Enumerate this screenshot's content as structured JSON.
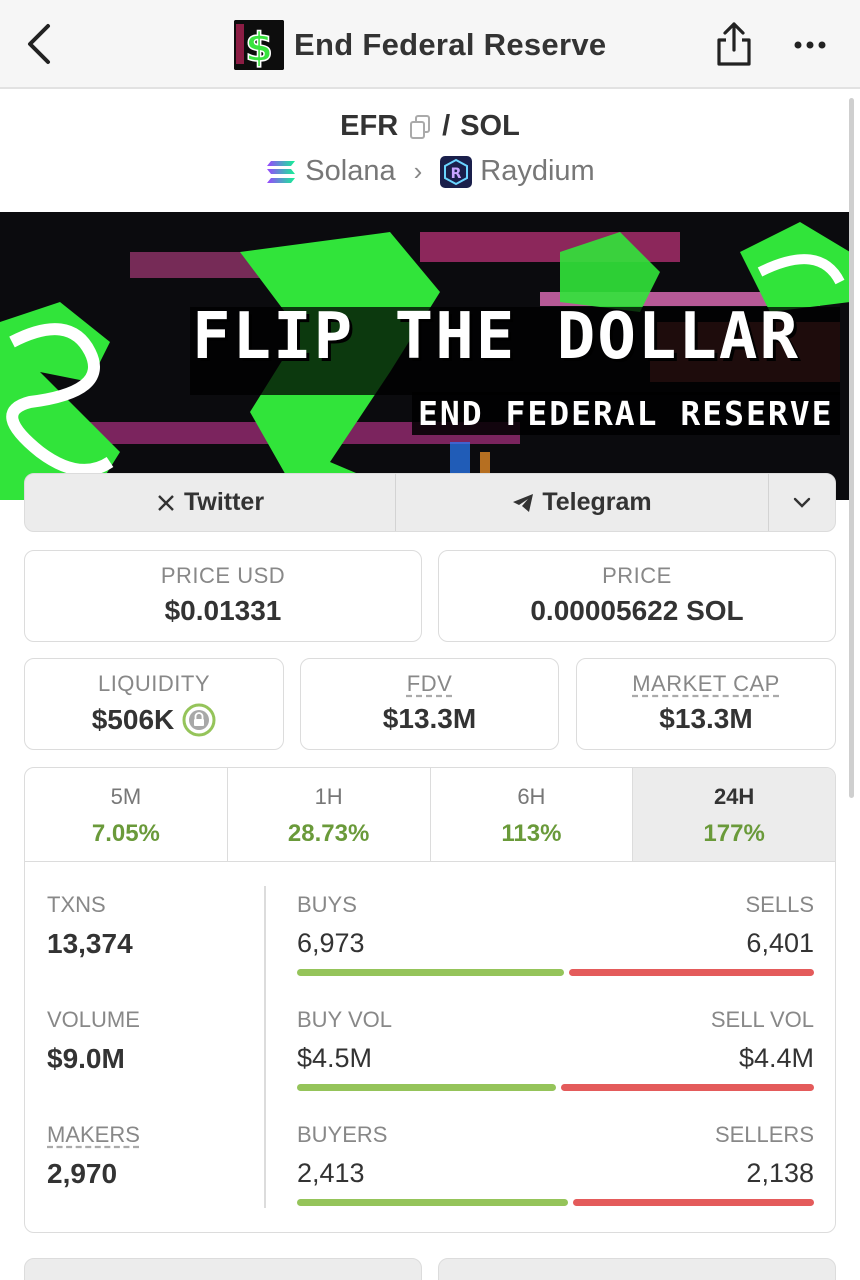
{
  "header": {
    "title": "End Federal Reserve",
    "back_icon": "chevron-left-icon",
    "share_icon": "share-icon",
    "more_icon": "more-horizontal-icon"
  },
  "pair": {
    "base": "EFR",
    "separator": "/",
    "quote": "SOL",
    "chain": "Solana",
    "dex": "Raydium"
  },
  "banner": {
    "line1": "FLIP THE DOLLAR",
    "line2": "END FEDERAL RESERVE"
  },
  "links": {
    "twitter": "Twitter",
    "telegram": "Telegram"
  },
  "prices": {
    "price_usd_label": "PRICE USD",
    "price_usd": "$0.01331",
    "price_label": "PRICE",
    "price_sol": "0.00005622 SOL"
  },
  "metrics": {
    "liquidity_label": "LIQUIDITY",
    "liquidity": "$506K",
    "fdv_label": "FDV",
    "fdv": "$13.3M",
    "mcap_label": "MARKET CAP",
    "mcap": "$13.3M"
  },
  "timeframes": [
    {
      "label": "5M",
      "change": "7.05%"
    },
    {
      "label": "1H",
      "change": "28.73%"
    },
    {
      "label": "6H",
      "change": "113%"
    },
    {
      "label": "24H",
      "change": "177%"
    }
  ],
  "stats": {
    "txns_label": "TXNS",
    "txns": "13,374",
    "volume_label": "VOLUME",
    "volume": "$9.0M",
    "makers_label": "MAKERS",
    "makers": "2,970",
    "buys_label": "BUYS",
    "buys": "6,973",
    "sells_label": "SELLS",
    "sells": "6,401",
    "buy_vol_label": "BUY VOL",
    "buy_vol": "$4.5M",
    "sell_vol_label": "SELL VOL",
    "sell_vol": "$4.4M",
    "buyers_label": "BUYERS",
    "buyers": "2,413",
    "sellers_label": "SELLERS",
    "sellers": "2,138"
  },
  "bar_fractions": {
    "buys_share": 0.521,
    "buy_vol_share": 0.506,
    "buyers_share": 0.53
  },
  "colors": {
    "positive": "#6a9a3a",
    "buy_bar": "#95c45a",
    "sell_bar": "#e45b5b"
  }
}
